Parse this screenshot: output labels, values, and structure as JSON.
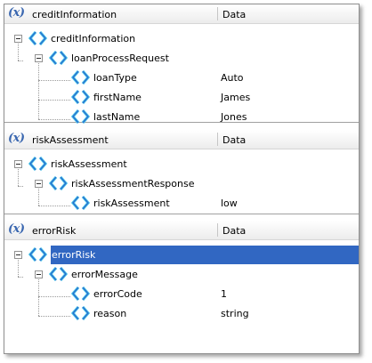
{
  "header": {
    "data_label": "Data"
  },
  "panels": [
    {
      "title": "creditInformation",
      "nodes": [
        {
          "label": "creditInformation",
          "value": ""
        },
        {
          "label": "loanProcessRequest",
          "value": ""
        },
        {
          "label": "loanType",
          "value": "Auto"
        },
        {
          "label": "firstName",
          "value": "James"
        },
        {
          "label": "lastName",
          "value": "Jones"
        }
      ]
    },
    {
      "title": "riskAssessment",
      "nodes": [
        {
          "label": "riskAssessment",
          "value": ""
        },
        {
          "label": "riskAssessmentResponse",
          "value": ""
        },
        {
          "label": "riskAssessment",
          "value": "low"
        }
      ]
    },
    {
      "title": "errorRisk",
      "nodes": [
        {
          "label": "errorRisk",
          "value": ""
        },
        {
          "label": "errorMessage",
          "value": ""
        },
        {
          "label": "errorCode",
          "value": "1"
        },
        {
          "label": "reason",
          "value": "string"
        }
      ]
    }
  ],
  "selected": "errorRisk",
  "icons": {
    "variable": "variable-x-icon",
    "node": "element-node-icon"
  },
  "colors": {
    "accent": "#3a67b0",
    "selection": "#3167c2",
    "icon_blue": "#2a6fd0",
    "icon_cyan": "#49c8e8"
  }
}
